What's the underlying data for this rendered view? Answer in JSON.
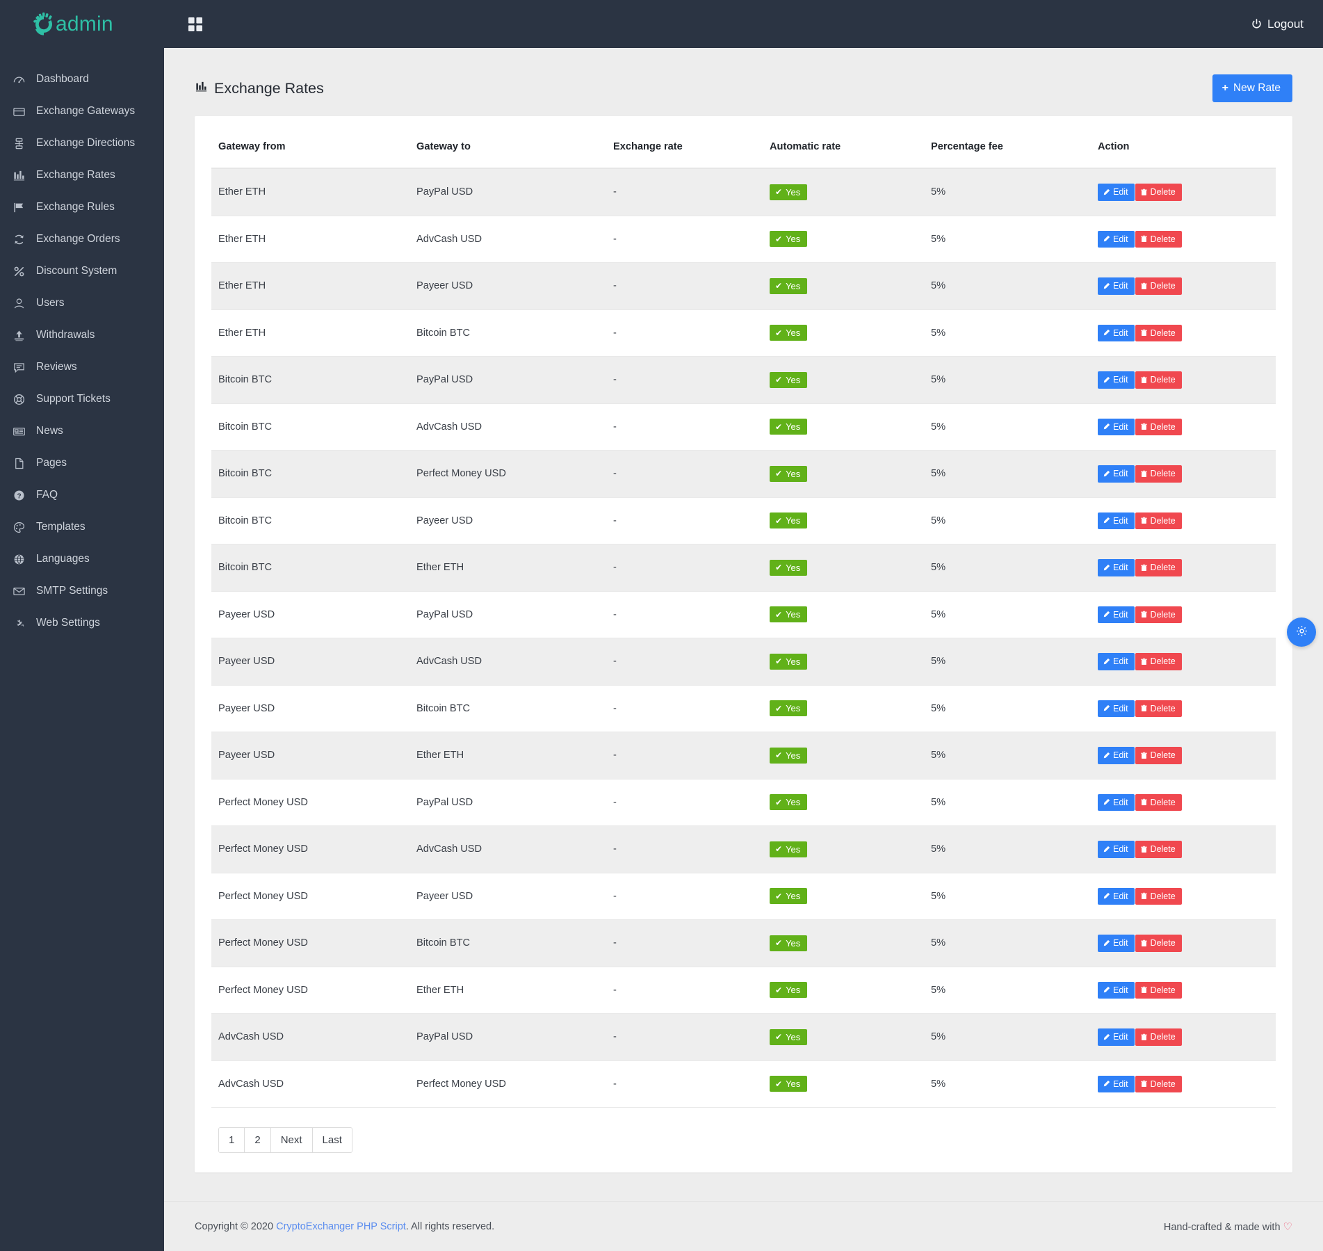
{
  "brand": {
    "text": "admin",
    "logo_icon": "c-spinner-logo",
    "accent": "#2ebfa5"
  },
  "topbar": {
    "grid_icon": "grid-squares-icon",
    "logout_label": "Logout",
    "logout_icon": "power-icon",
    "background": "#2b3443"
  },
  "sidebar": {
    "items": [
      {
        "label": "Dashboard",
        "icon": "speedometer-icon"
      },
      {
        "label": "Exchange Gateways",
        "icon": "credit-card-icon"
      },
      {
        "label": "Exchange Directions",
        "icon": "sitemap-icon"
      },
      {
        "label": "Exchange Rates",
        "icon": "bar-chart-icon"
      },
      {
        "label": "Exchange Rules",
        "icon": "flag-icon"
      },
      {
        "label": "Exchange Orders",
        "icon": "refresh-cycle-icon"
      },
      {
        "label": "Discount System",
        "icon": "percent-icon"
      },
      {
        "label": "Users",
        "icon": "user-icon"
      },
      {
        "label": "Withdrawals",
        "icon": "upload-icon"
      },
      {
        "label": "Reviews",
        "icon": "comment-icon"
      },
      {
        "label": "Support Tickets",
        "icon": "life-ring-icon"
      },
      {
        "label": "News",
        "icon": "newspaper-icon"
      },
      {
        "label": "Pages",
        "icon": "file-icon"
      },
      {
        "label": "FAQ",
        "icon": "question-circle-icon"
      },
      {
        "label": "Templates",
        "icon": "palette-icon"
      },
      {
        "label": "Languages",
        "icon": "globe-icon"
      },
      {
        "label": "SMTP Settings",
        "icon": "envelope-icon"
      },
      {
        "label": "Web Settings",
        "icon": "gears-icon"
      }
    ]
  },
  "page": {
    "title": "Exchange Rates",
    "title_icon": "bar-chart-icon",
    "new_button_label": "New Rate",
    "new_button_icon": "plus-icon",
    "new_button_color": "#2f80f7"
  },
  "table": {
    "headers": [
      "Gateway from",
      "Gateway to",
      "Exchange rate",
      "Automatic rate",
      "Percentage fee",
      "Action"
    ],
    "edit_label": "Edit",
    "edit_icon": "pencil-icon",
    "delete_label": "Delete",
    "delete_icon": "trash-icon",
    "yes_label": "Yes",
    "yes_icon": "check-icon",
    "yes_color": "#61b119",
    "rows": [
      {
        "from": "Ether ETH",
        "to": "PayPal USD",
        "rate": "-",
        "automatic": "Yes",
        "fee": "5%"
      },
      {
        "from": "Ether ETH",
        "to": "AdvCash USD",
        "rate": "-",
        "automatic": "Yes",
        "fee": "5%"
      },
      {
        "from": "Ether ETH",
        "to": "Payeer USD",
        "rate": "-",
        "automatic": "Yes",
        "fee": "5%"
      },
      {
        "from": "Ether ETH",
        "to": "Bitcoin BTC",
        "rate": "-",
        "automatic": "Yes",
        "fee": "5%"
      },
      {
        "from": "Bitcoin BTC",
        "to": "PayPal USD",
        "rate": "-",
        "automatic": "Yes",
        "fee": "5%"
      },
      {
        "from": "Bitcoin BTC",
        "to": "AdvCash USD",
        "rate": "-",
        "automatic": "Yes",
        "fee": "5%"
      },
      {
        "from": "Bitcoin BTC",
        "to": "Perfect Money USD",
        "rate": "-",
        "automatic": "Yes",
        "fee": "5%"
      },
      {
        "from": "Bitcoin BTC",
        "to": "Payeer USD",
        "rate": "-",
        "automatic": "Yes",
        "fee": "5%"
      },
      {
        "from": "Bitcoin BTC",
        "to": "Ether ETH",
        "rate": "-",
        "automatic": "Yes",
        "fee": "5%"
      },
      {
        "from": "Payeer USD",
        "to": "PayPal USD",
        "rate": "-",
        "automatic": "Yes",
        "fee": "5%"
      },
      {
        "from": "Payeer USD",
        "to": "AdvCash USD",
        "rate": "-",
        "automatic": "Yes",
        "fee": "5%"
      },
      {
        "from": "Payeer USD",
        "to": "Bitcoin BTC",
        "rate": "-",
        "automatic": "Yes",
        "fee": "5%"
      },
      {
        "from": "Payeer USD",
        "to": "Ether ETH",
        "rate": "-",
        "automatic": "Yes",
        "fee": "5%"
      },
      {
        "from": "Perfect Money USD",
        "to": "PayPal USD",
        "rate": "-",
        "automatic": "Yes",
        "fee": "5%"
      },
      {
        "from": "Perfect Money USD",
        "to": "AdvCash USD",
        "rate": "-",
        "automatic": "Yes",
        "fee": "5%"
      },
      {
        "from": "Perfect Money USD",
        "to": "Payeer USD",
        "rate": "-",
        "automatic": "Yes",
        "fee": "5%"
      },
      {
        "from": "Perfect Money USD",
        "to": "Bitcoin BTC",
        "rate": "-",
        "automatic": "Yes",
        "fee": "5%"
      },
      {
        "from": "Perfect Money USD",
        "to": "Ether ETH",
        "rate": "-",
        "automatic": "Yes",
        "fee": "5%"
      },
      {
        "from": "AdvCash USD",
        "to": "PayPal USD",
        "rate": "-",
        "automatic": "Yes",
        "fee": "5%"
      },
      {
        "from": "AdvCash USD",
        "to": "Perfect Money USD",
        "rate": "-",
        "automatic": "Yes",
        "fee": "5%"
      }
    ]
  },
  "pagination": {
    "items": [
      "1",
      "2",
      "Next",
      "Last"
    ]
  },
  "footer": {
    "copyright_prefix": "Copyright © 2020 ",
    "link_label": "CryptoExchanger PHP Script",
    "copyright_suffix": ". All rights reserved.",
    "credit": "Hand-crafted & made with",
    "heart_icon": "heart-icon"
  },
  "fab": {
    "icon": "gear-icon",
    "color": "#2f80f7"
  }
}
